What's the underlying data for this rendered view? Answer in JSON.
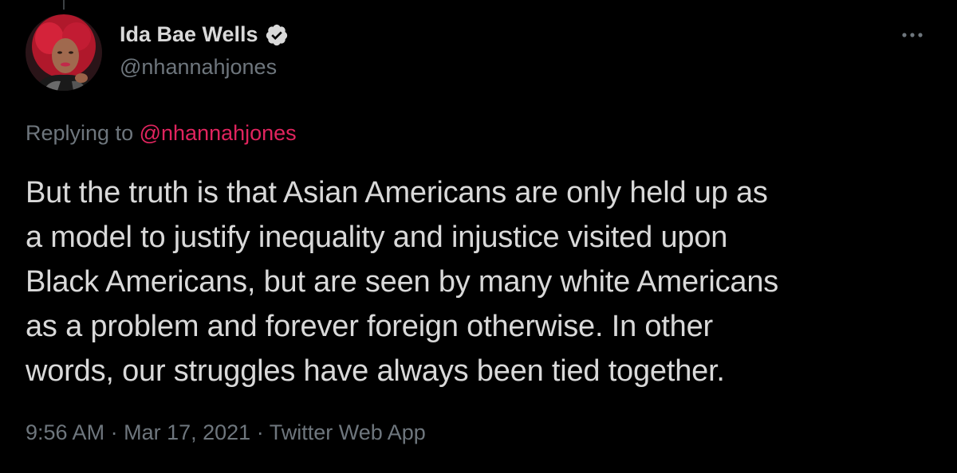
{
  "tweet": {
    "author": {
      "display_name": "Ida Bae Wells",
      "handle": "@nhannahjones",
      "verified_icon": "verified-badge-icon"
    },
    "more_icon": "more-options-icon",
    "replying_prefix": "Replying to",
    "replying_to": "@nhannahjones",
    "text_lines": [
      "But the truth is that Asian Americans are only held up as",
      "a model to justify inequality and injustice visited upon",
      "Black Americans, but are seen by many white Americans",
      "as a problem and forever foreign otherwise. In other",
      "words, our struggles have always been tied together."
    ],
    "time": "9:56 AM",
    "separator": "·",
    "date": "Mar 17, 2021",
    "source": "Twitter Web App"
  },
  "colors": {
    "background": "#000000",
    "primary_text": "#d9d9d9",
    "secondary_text": "#6e767d",
    "mention": "#e0245e"
  }
}
